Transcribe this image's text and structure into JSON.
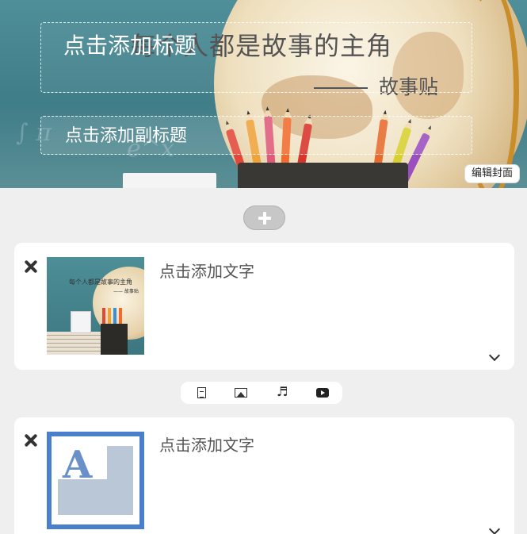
{
  "cover": {
    "background_quote": "每个人都是故事的主角",
    "background_quote_author": "故事贴",
    "title_placeholder": "点击添加标题",
    "subtitle_placeholder": "点击添加副标题",
    "edit_cover_label": "编辑封面"
  },
  "add_button": {
    "icon": "plus-icon"
  },
  "cards": [
    {
      "text_placeholder": "点击添加文字",
      "image": "classroom-globe-pencils-photo",
      "thumb_quote": "每个人都是故事的主角",
      "thumb_author": "—— 故事贴"
    },
    {
      "text_placeholder": "点击添加文字",
      "image": "image-placeholder"
    }
  ],
  "toolbar": {
    "items": [
      "document-icon",
      "image-icon",
      "music-icon",
      "video-icon"
    ]
  },
  "colors": {
    "page_bg": "#efefef",
    "card_bg": "#ffffff",
    "placeholder_blue": "#4a7fcd"
  }
}
